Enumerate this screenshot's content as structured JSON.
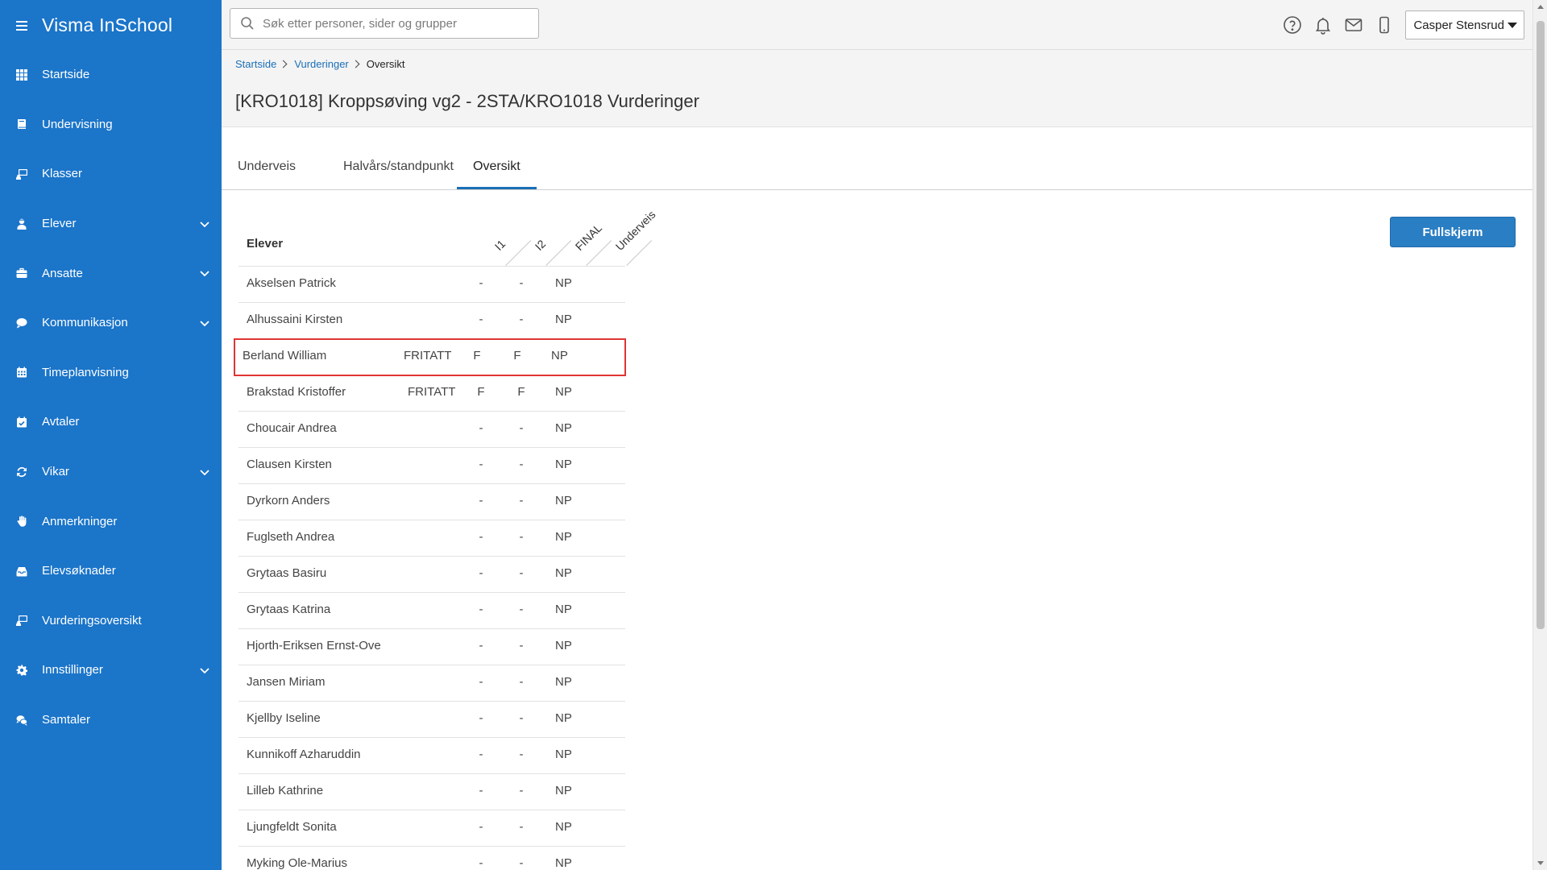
{
  "app": {
    "title": "Visma InSchool"
  },
  "sidebar": {
    "items": [
      {
        "label": "Startside",
        "icon": "grid-icon",
        "expandable": false
      },
      {
        "label": "Undervisning",
        "icon": "book-icon",
        "expandable": false
      },
      {
        "label": "Klasser",
        "icon": "class-board-icon",
        "expandable": false
      },
      {
        "label": "Elever",
        "icon": "student-icon",
        "expandable": true
      },
      {
        "label": "Ansatte",
        "icon": "briefcase-icon",
        "expandable": true
      },
      {
        "label": "Kommunikasjon",
        "icon": "chat-bubble-icon",
        "expandable": true
      },
      {
        "label": "Timeplanvisning",
        "icon": "calendar-icon",
        "expandable": false
      },
      {
        "label": "Avtaler",
        "icon": "calendar-check-icon",
        "expandable": false
      },
      {
        "label": "Vikar",
        "icon": "refresh-icon",
        "expandable": true
      },
      {
        "label": "Anmerkninger",
        "icon": "hand-icon",
        "expandable": false
      },
      {
        "label": "Elevsøknader",
        "icon": "inbox-icon",
        "expandable": false
      },
      {
        "label": "Vurderingsoversikt",
        "icon": "class-board-icon",
        "expandable": false
      },
      {
        "label": "Innstillinger",
        "icon": "gear-icon",
        "expandable": true
      },
      {
        "label": "Samtaler",
        "icon": "chat-bubbles-icon",
        "expandable": false
      }
    ]
  },
  "search": {
    "placeholder": "Søk etter personer, sider og grupper",
    "value": ""
  },
  "user": {
    "name": "Casper Stensrud"
  },
  "breadcrumb": {
    "items": [
      "Startside",
      "Vurderinger"
    ],
    "current": "Oversikt"
  },
  "page": {
    "title": "[KRO1018] Kroppsøving vg2 - 2STA/KRO1018 Vurderinger"
  },
  "tabs": [
    {
      "label": "Underveis",
      "active": false
    },
    {
      "label": "Halvårs/standpunkt",
      "active": false
    },
    {
      "label": "Oversikt",
      "active": true
    }
  ],
  "fullscreen_label": "Fullskjerm",
  "table": {
    "header": {
      "name_col": "Elever",
      "columns": [
        "I1",
        "I2",
        "FINAL",
        "Underveis"
      ]
    },
    "rows": [
      {
        "name": "Akselsen Patrick",
        "status": "",
        "i1": "-",
        "i2": "-",
        "final": "NP"
      },
      {
        "name": "Alhussaini Kirsten",
        "status": "",
        "i1": "-",
        "i2": "-",
        "final": "NP"
      },
      {
        "name": "Berland William",
        "status": "FRITATT",
        "i1": "F",
        "i2": "F",
        "final": "NP",
        "highlighted": true
      },
      {
        "name": "Brakstad Kristoffer",
        "status": "FRITATT",
        "i1": "F",
        "i2": "F",
        "final": "NP"
      },
      {
        "name": "Choucair Andrea",
        "status": "",
        "i1": "-",
        "i2": "-",
        "final": "NP"
      },
      {
        "name": "Clausen Kirsten",
        "status": "",
        "i1": "-",
        "i2": "-",
        "final": "NP"
      },
      {
        "name": "Dyrkorn Anders",
        "status": "",
        "i1": "-",
        "i2": "-",
        "final": "NP"
      },
      {
        "name": "Fuglseth Andrea",
        "status": "",
        "i1": "-",
        "i2": "-",
        "final": "NP"
      },
      {
        "name": "Grytaas Basiru",
        "status": "",
        "i1": "-",
        "i2": "-",
        "final": "NP"
      },
      {
        "name": "Grytaas Katrina",
        "status": "",
        "i1": "-",
        "i2": "-",
        "final": "NP"
      },
      {
        "name": "Hjorth-Eriksen Ernst-Ove",
        "status": "",
        "i1": "-",
        "i2": "-",
        "final": "NP"
      },
      {
        "name": "Jansen Miriam",
        "status": "",
        "i1": "-",
        "i2": "-",
        "final": "NP"
      },
      {
        "name": "Kjellby Iseline",
        "status": "",
        "i1": "-",
        "i2": "-",
        "final": "NP"
      },
      {
        "name": "Kunnikoff Azharuddin",
        "status": "",
        "i1": "-",
        "i2": "-",
        "final": "NP"
      },
      {
        "name": "Lilleb Kathrine",
        "status": "",
        "i1": "-",
        "i2": "-",
        "final": "NP"
      },
      {
        "name": "Ljungfeldt Sonita",
        "status": "",
        "i1": "-",
        "i2": "-",
        "final": "NP"
      },
      {
        "name": "Myking Ole-Marius",
        "status": "",
        "i1": "-",
        "i2": "-",
        "final": "NP"
      }
    ]
  },
  "colors": {
    "sidebar": "#1b75c9",
    "accent": "#2a7ec3",
    "highlight": "#e03434"
  }
}
